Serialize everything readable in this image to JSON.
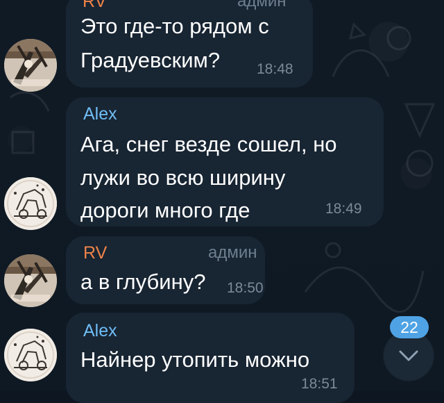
{
  "messages": [
    {
      "sender": "RV",
      "role": "админ",
      "text_line_1": "Это где-то рядом с",
      "text_line_2": "Градуевским?",
      "time": "18:48"
    },
    {
      "sender": "Alex",
      "text_line_1": "Ага, снег везде сошел, но",
      "text_line_2": "лужи во всю ширину",
      "text_line_3": "дороги много где",
      "time": "18:49"
    },
    {
      "sender": "RV",
      "role": "админ",
      "text_line_1": "а в глубину?",
      "time": "18:50"
    },
    {
      "sender": "Alex",
      "text_line_1": "Найнер утопить можно",
      "time": "18:51"
    }
  ],
  "scroll_badge": "22",
  "icons": {
    "scroll_down": "chevron-down-icon"
  },
  "colors": {
    "background": "#0e1621",
    "bubble": "#182533",
    "rv_name": "#ef8348",
    "alex_name": "#70bdf6",
    "badge": "#4fa3e4"
  }
}
